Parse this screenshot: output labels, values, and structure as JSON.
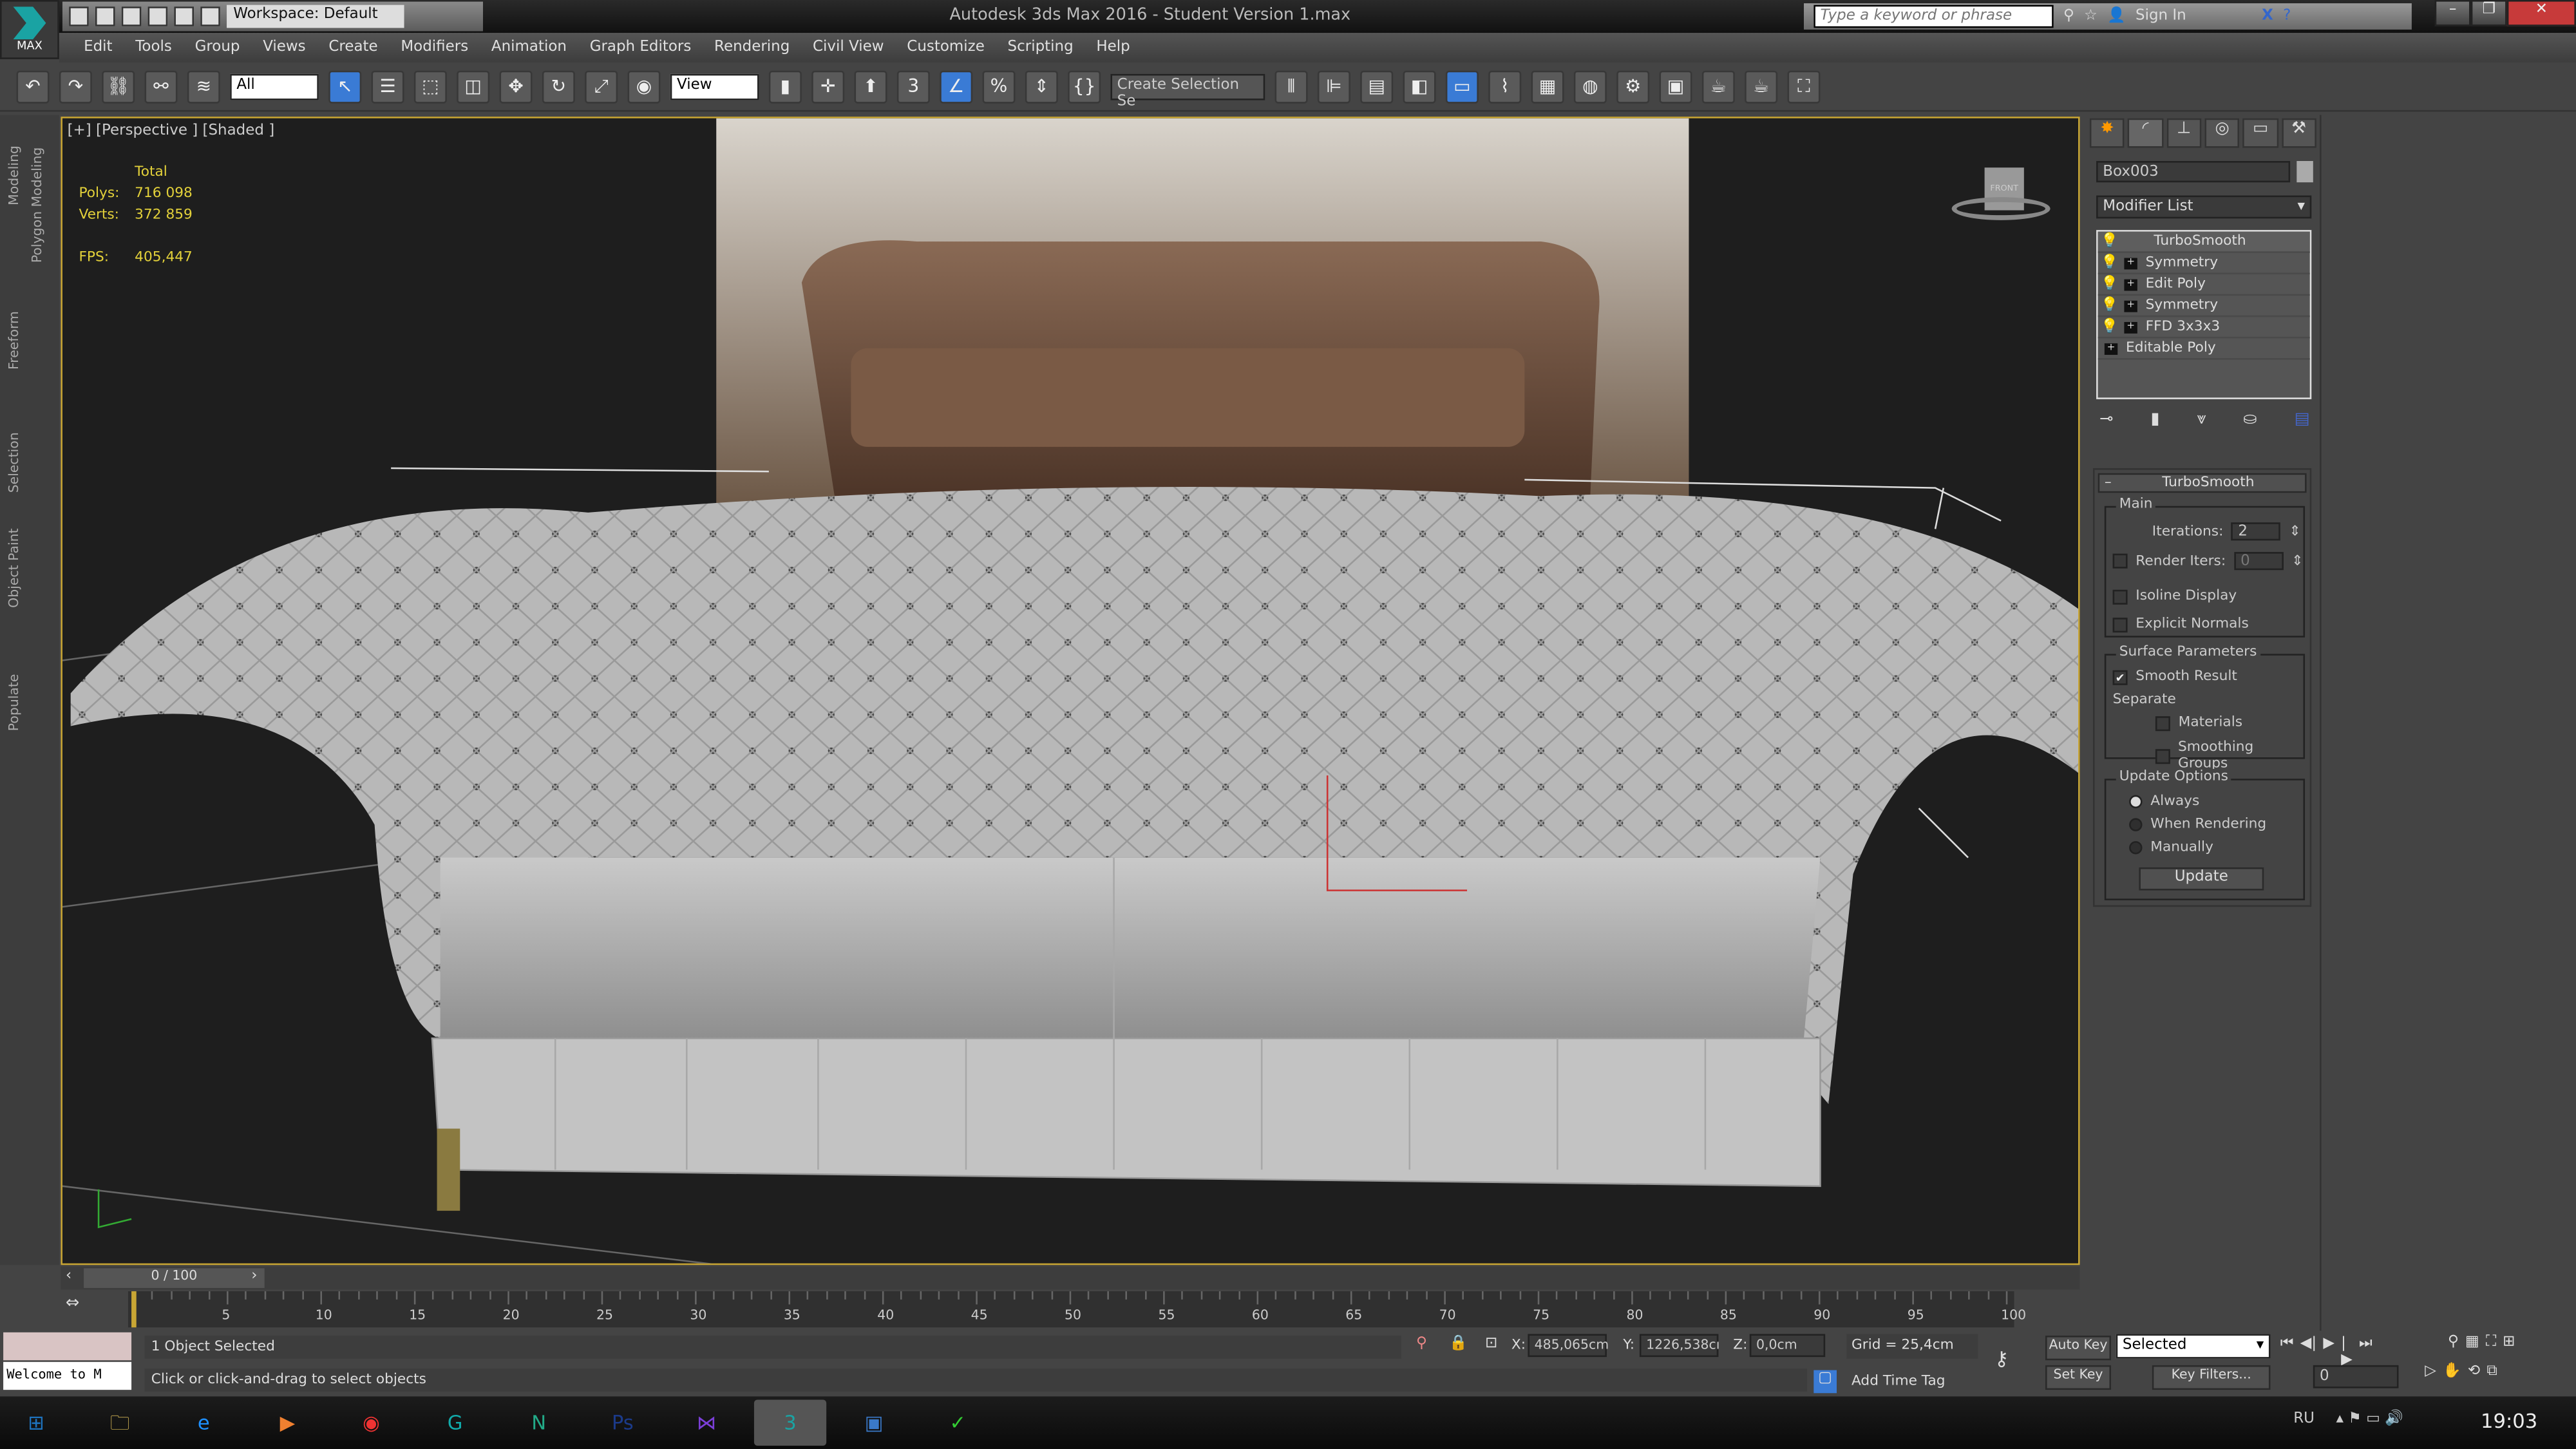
{
  "app": {
    "title": "Autodesk 3ds Max 2016 - Student Version    1.max",
    "logo_text": "MAX",
    "workspace": "Workspace: Default"
  },
  "search": {
    "placeholder": "Type a keyword or phrase",
    "sign_in": "Sign In"
  },
  "menu": [
    "Edit",
    "Tools",
    "Group",
    "Views",
    "Create",
    "Modifiers",
    "Animation",
    "Graph Editors",
    "Rendering",
    "Civil View",
    "Customize",
    "Scripting",
    "Help"
  ],
  "toolbar": {
    "selection_filter": "All",
    "ref_coord": "View",
    "named_selection": "Create Selection Se"
  },
  "left_tabs": [
    "Modeling",
    "Polygon Modeling",
    "Freeform",
    "Selection",
    "Object Paint",
    "Populate"
  ],
  "viewport": {
    "label": "[+] [Perspective ] [Shaded ]",
    "stats": {
      "header": "Total",
      "polys_label": "Polys:",
      "polys": "716 098",
      "verts_label": "Verts:",
      "verts": "372 859",
      "fps_label": "FPS:",
      "fps": "405,447"
    },
    "viewcube_label": "FRONT"
  },
  "command_panel": {
    "object_name": "Box003",
    "modifier_list": "Modifier List",
    "stack": [
      "TurboSmooth",
      "Symmetry",
      "Edit Poly",
      "Symmetry",
      "FFD 3x3x3",
      "Editable Poly"
    ],
    "rollout_title": "TurboSmooth",
    "main": {
      "title": "Main",
      "iterations_label": "Iterations:",
      "iterations": "2",
      "render_iters_label": "Render Iters:",
      "render_iters": "0",
      "isoline": "Isoline Display",
      "explicit": "Explicit Normals"
    },
    "surface": {
      "title": "Surface Parameters",
      "smooth_result": "Smooth Result",
      "separate": "Separate",
      "materials": "Materials",
      "smoothing_groups": "Smoothing Groups"
    },
    "update": {
      "title": "Update Options",
      "always": "Always",
      "when_rendering": "When Rendering",
      "manually": "Manually",
      "button": "Update"
    }
  },
  "timeline": {
    "frame": "0 / 100",
    "ticks": [
      "5",
      "10",
      "15",
      "20",
      "25",
      "30",
      "35",
      "40",
      "45",
      "50",
      "55",
      "60",
      "65",
      "70",
      "75",
      "80",
      "85",
      "90",
      "95",
      "100"
    ]
  },
  "status": {
    "maxscript": "Welcome to M",
    "selected": "1 Object Selected",
    "prompt": "Click or click-and-drag to select objects",
    "x_label": "X:",
    "x": "485,065cm",
    "y_label": "Y:",
    "y": "1226,538cı",
    "z_label": "Z:",
    "z": "0,0cm",
    "grid": "Grid = 25,4cm",
    "add_time_tag": "Add Time Tag",
    "auto_key": "Auto Key",
    "set_key": "Set Key",
    "key_mode": "Selected",
    "key_filters": "Key Filters...",
    "current_frame": "0"
  },
  "taskbar": {
    "lang": "RU",
    "clock": "19:03",
    "apps": [
      "Start",
      "Explorer",
      "Internet Explorer",
      "Media Player",
      "Chrome",
      "Corel",
      "Navisworks",
      "Photoshop",
      "Visual Studio",
      "3ds Max",
      "Remote Desktop",
      "Green App"
    ]
  }
}
